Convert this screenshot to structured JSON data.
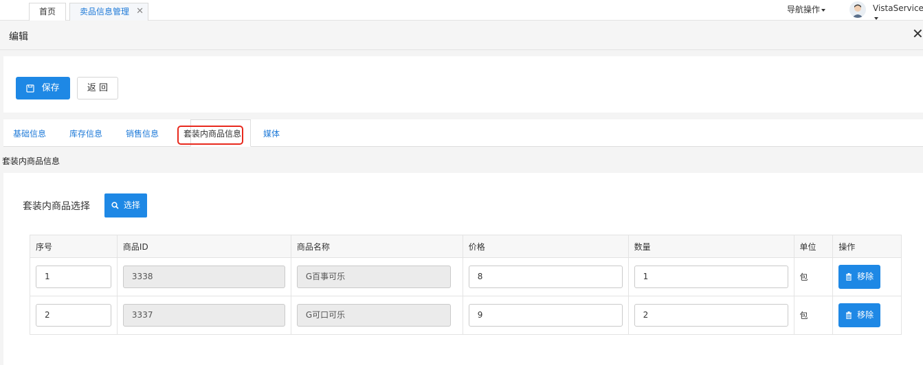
{
  "top_tabs": {
    "home": "首页",
    "active": "卖品信息管理",
    "close": "✕"
  },
  "header": {
    "nav_ops": "导航操作",
    "user": "VistaService"
  },
  "edit": {
    "title": "编辑",
    "close": "✕"
  },
  "actions": {
    "save": "保存",
    "back": "返 回"
  },
  "section_tabs": [
    {
      "label": "基础信息"
    },
    {
      "label": "库存信息"
    },
    {
      "label": "销售信息"
    },
    {
      "label": "套装内商品信息"
    },
    {
      "label": "媒体"
    }
  ],
  "section_label": "套装内商品信息",
  "selector": {
    "label": "套装内商品选择",
    "button": "选择"
  },
  "table": {
    "headers": [
      "序号",
      "商品ID",
      "商品名称",
      "价格",
      "数量",
      "单位",
      "操作"
    ],
    "rows": [
      {
        "seq": "1",
        "id": "3338",
        "name": "G百事可乐",
        "price": "8",
        "qty": "1",
        "unit": "包",
        "action": "移除"
      },
      {
        "seq": "2",
        "id": "3337",
        "name": "G可口可乐",
        "price": "9",
        "qty": "2",
        "unit": "包",
        "action": "移除"
      }
    ]
  },
  "colors": {
    "primary": "#1e88e5",
    "highlight": "#e8281c"
  }
}
